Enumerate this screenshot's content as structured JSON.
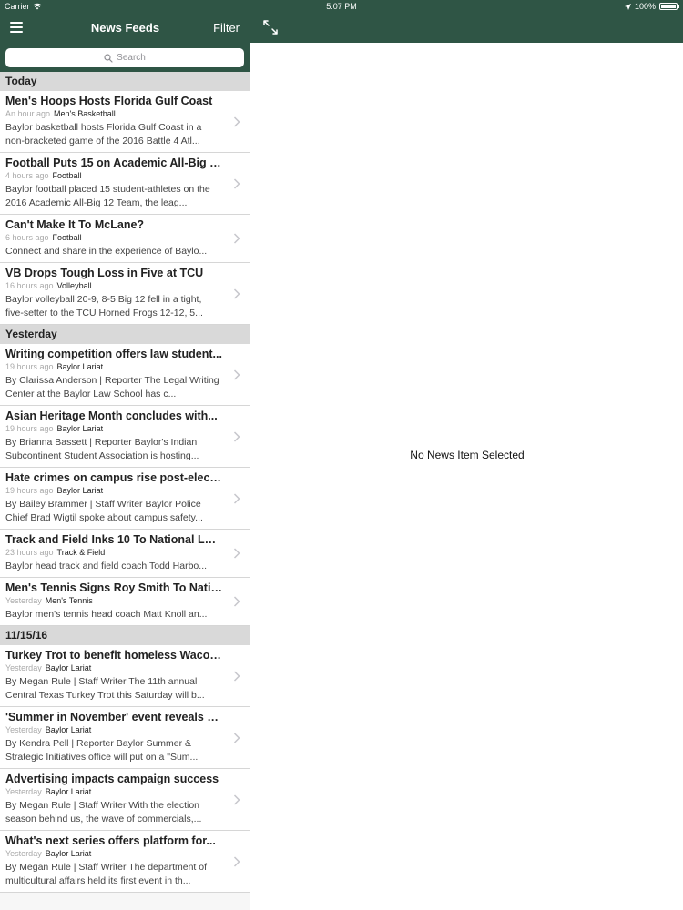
{
  "status": {
    "carrier": "Carrier",
    "time": "5:07 PM",
    "battery": "100%"
  },
  "nav": {
    "title": "News Feeds",
    "filter_label": "Filter"
  },
  "search": {
    "placeholder": "Search"
  },
  "sections": [
    {
      "header": "Today",
      "items": [
        {
          "title": "Men's Hoops Hosts Florida Gulf Coast",
          "time": "An hour ago",
          "category": "Men's Basketball",
          "summary": "Baylor basketball hosts Florida Gulf Coast in a non-bracketed game of the 2016 Battle 4 Atl..."
        },
        {
          "title": "Football Puts 15 on Academic All-Big 1...",
          "time": "4 hours ago",
          "category": "Football",
          "summary": "Baylor football placed 15 student-athletes on the 2016 Academic All-Big 12 Team, the leag..."
        },
        {
          "title": "Can't Make It To McLane?",
          "time": "6 hours ago",
          "category": "Football",
          "summary": "Connect and share in the experience of Baylo..."
        },
        {
          "title": "VB Drops Tough Loss in Five at TCU",
          "time": "16 hours ago",
          "category": "Volleyball",
          "summary": "Baylor volleyball 20-9, 8-5 Big 12 fell in a tight, five-setter to the TCU Horned Frogs 12-12, 5..."
        }
      ]
    },
    {
      "header": "Yesterday",
      "items": [
        {
          "title": "Writing competition offers law student...",
          "time": "19 hours ago",
          "category": "Baylor Lariat",
          "summary": "By Clarissa Anderson | Reporter The Legal Writing Center at the Baylor Law School has c..."
        },
        {
          "title": "Asian Heritage Month concludes with...",
          "time": "19 hours ago",
          "category": "Baylor Lariat",
          "summary": "By Brianna Bassett | Reporter Baylor's Indian Subcontinent Student Association is hosting..."
        },
        {
          "title": "Hate crimes on campus rise post-elect...",
          "time": "19 hours ago",
          "category": "Baylor Lariat",
          "summary": "By Bailey Brammer | Staff Writer Baylor Police Chief Brad Wigtil spoke about campus safety..."
        },
        {
          "title": "Track and Field Inks 10 To National Lett...",
          "time": "23 hours ago",
          "category": "Track & Field",
          "summary": "Baylor head track and field coach Todd Harbo..."
        },
        {
          "title": "Men's Tennis Signs Roy Smith To Natio...",
          "time": "Yesterday",
          "category": "Men's Tennis",
          "summary": "Baylor men's tennis head coach Matt Knoll an..."
        }
      ]
    },
    {
      "header": "11/15/16",
      "items": [
        {
          "title": "Turkey Trot to benefit homeless Waco I...",
          "time": "Yesterday",
          "category": "Baylor Lariat",
          "summary": "By Megan Rule | Staff Writer The 11th annual Central Texas Turkey Trot this Saturday will b..."
        },
        {
          "title": "'Summer in November' event reveals B...",
          "time": "Yesterday",
          "category": "Baylor Lariat",
          "summary": "By Kendra Pell | Reporter Baylor Summer & Strategic Initiatives office will put on a \"Sum..."
        },
        {
          "title": "Advertising impacts campaign success",
          "time": "Yesterday",
          "category": "Baylor Lariat",
          "summary": "By Megan Rule | Staff Writer With the election season behind us, the wave of commercials,..."
        },
        {
          "title": "What's next series offers platform for...",
          "time": "Yesterday",
          "category": "Baylor Lariat",
          "summary": "By Megan Rule | Staff Writer The department of multicultural affairs held its first event in th..."
        }
      ]
    }
  ],
  "detail": {
    "empty_message": "No News Item Selected"
  },
  "colors": {
    "header_green": "#2f5545",
    "section_gray": "#d9d9d9"
  }
}
